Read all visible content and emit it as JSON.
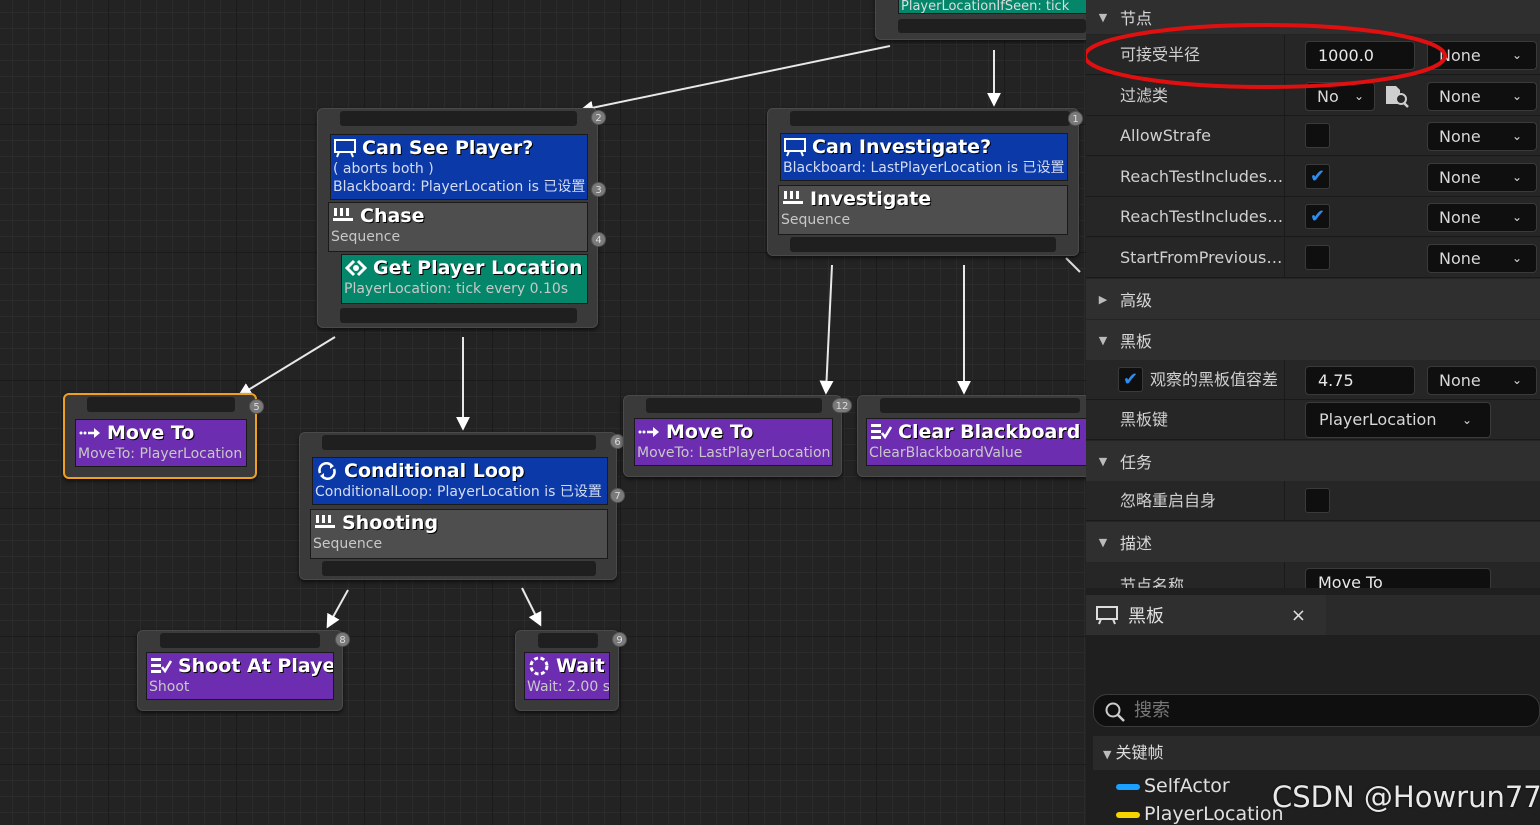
{
  "graph": {
    "top_partial_label": "PlayerLocationIfSeen: tick",
    "can_see": {
      "title": "Can See Player?",
      "line1": "( aborts both )",
      "line2": "Blackboard: PlayerLocation is 已设置",
      "badge_top": "2",
      "badge_dec": "3"
    },
    "chase": {
      "title": "Chase",
      "sub": "Sequence",
      "badge": "4"
    },
    "get_player": {
      "title": "Get Player Location",
      "sub": "PlayerLocation: tick every 0.10s"
    },
    "can_invest": {
      "title": "Can Investigate?",
      "line1": "Blackboard: LastPlayerLocation is 已设置",
      "badge_top": "1"
    },
    "investigate": {
      "title": "Investigate",
      "sub": "Sequence"
    },
    "move_to_a": {
      "title": "Move To",
      "sub": "MoveTo: PlayerLocation",
      "badge": "5"
    },
    "cond_loop": {
      "title": "Conditional Loop",
      "line1": "ConditionalLoop: PlayerLocation is 已设置",
      "badge_top": "6",
      "badge_dec": "7"
    },
    "shooting": {
      "title": "Shooting",
      "sub": "Sequence"
    },
    "move_to_b": {
      "title": "Move To",
      "sub": "MoveTo: LastPlayerLocation",
      "badge": "12"
    },
    "clear_bb": {
      "title": "Clear Blackboard Va",
      "sub": "ClearBlackboardValue"
    },
    "shoot": {
      "title": "Shoot At Player",
      "sub": "Shoot",
      "badge": "8"
    },
    "wait": {
      "title": "Wait",
      "sub": "Wait: 2.00 s",
      "badge": "9"
    }
  },
  "details": {
    "sec_node": "节点",
    "rows": [
      {
        "label": "可接受半径",
        "value": "1000.0",
        "dd": "None"
      },
      {
        "label": "过滤类",
        "value": "No",
        "dd": "None"
      },
      {
        "label": "AllowStrafe",
        "checked": false,
        "dd": "None"
      },
      {
        "label": "ReachTestIncludesAg...",
        "checked": true,
        "dd": "None"
      },
      {
        "label": "ReachTestIncludesG...",
        "checked": true,
        "dd": "None"
      },
      {
        "label": "StartFromPreviousPa...",
        "checked": false,
        "dd": "None"
      }
    ],
    "sec_advanced": "高级",
    "sec_blackboard": "黑板",
    "tolerance_label": "观察的黑板值容差",
    "tolerance_value": "4.75",
    "tolerance_dd": "None",
    "bb_key_label": "黑板键",
    "bb_key_value": "PlayerLocation",
    "sec_task": "任务",
    "ignore_restart_label": "忽略重启自身",
    "sec_desc": "描述",
    "node_name_label": "节点名称",
    "node_name_value": "Move To"
  },
  "blackboard": {
    "tab": "黑板",
    "close": "×",
    "search_placeholder": "搜索",
    "category": "关键帧",
    "keys": [
      {
        "name": "SelfActor",
        "color": "#1aa0ff"
      },
      {
        "name": "PlayerLocation",
        "color": "#f5d400"
      }
    ]
  },
  "watermark": "CSDN @Howrun777",
  "colors": {
    "highlight_circle": "#e01010",
    "selected": "#f0a020"
  }
}
